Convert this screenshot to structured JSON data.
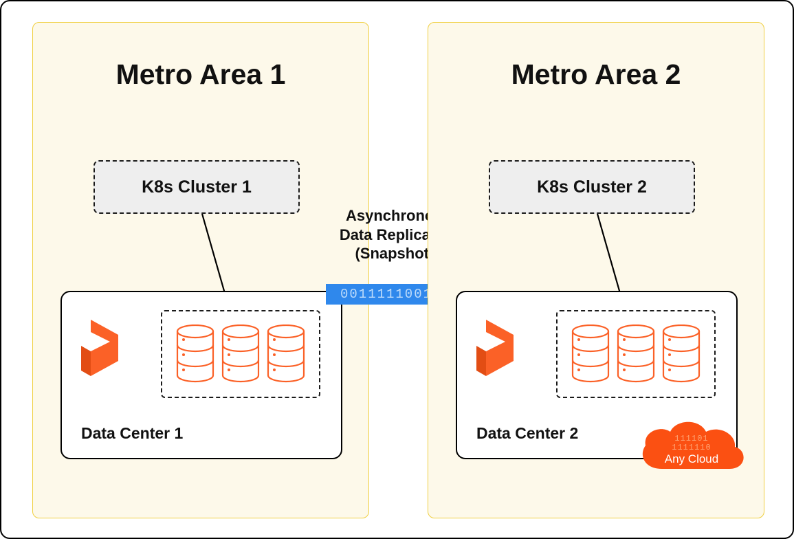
{
  "diagram": {
    "left": {
      "title": "Metro Area 1",
      "k8s": "K8s Cluster 1",
      "datacenter": "Data Center 1"
    },
    "right": {
      "title": "Metro Area 2",
      "k8s": "K8s Cluster 2",
      "datacenter": "Data Center 2"
    },
    "connector": {
      "line1": "Asynchronous",
      "line2": "Data Replication",
      "line3": "(Snapshots)",
      "binary": "0011111001"
    },
    "cloud": {
      "label": "Any Cloud",
      "binary": "111101\n1111110"
    },
    "colors": {
      "metroBg": "#fdf9ea",
      "metroBorder": "#f0cf3f",
      "orange": "#fb6127",
      "arrowBlue": "#2f88ec"
    }
  }
}
